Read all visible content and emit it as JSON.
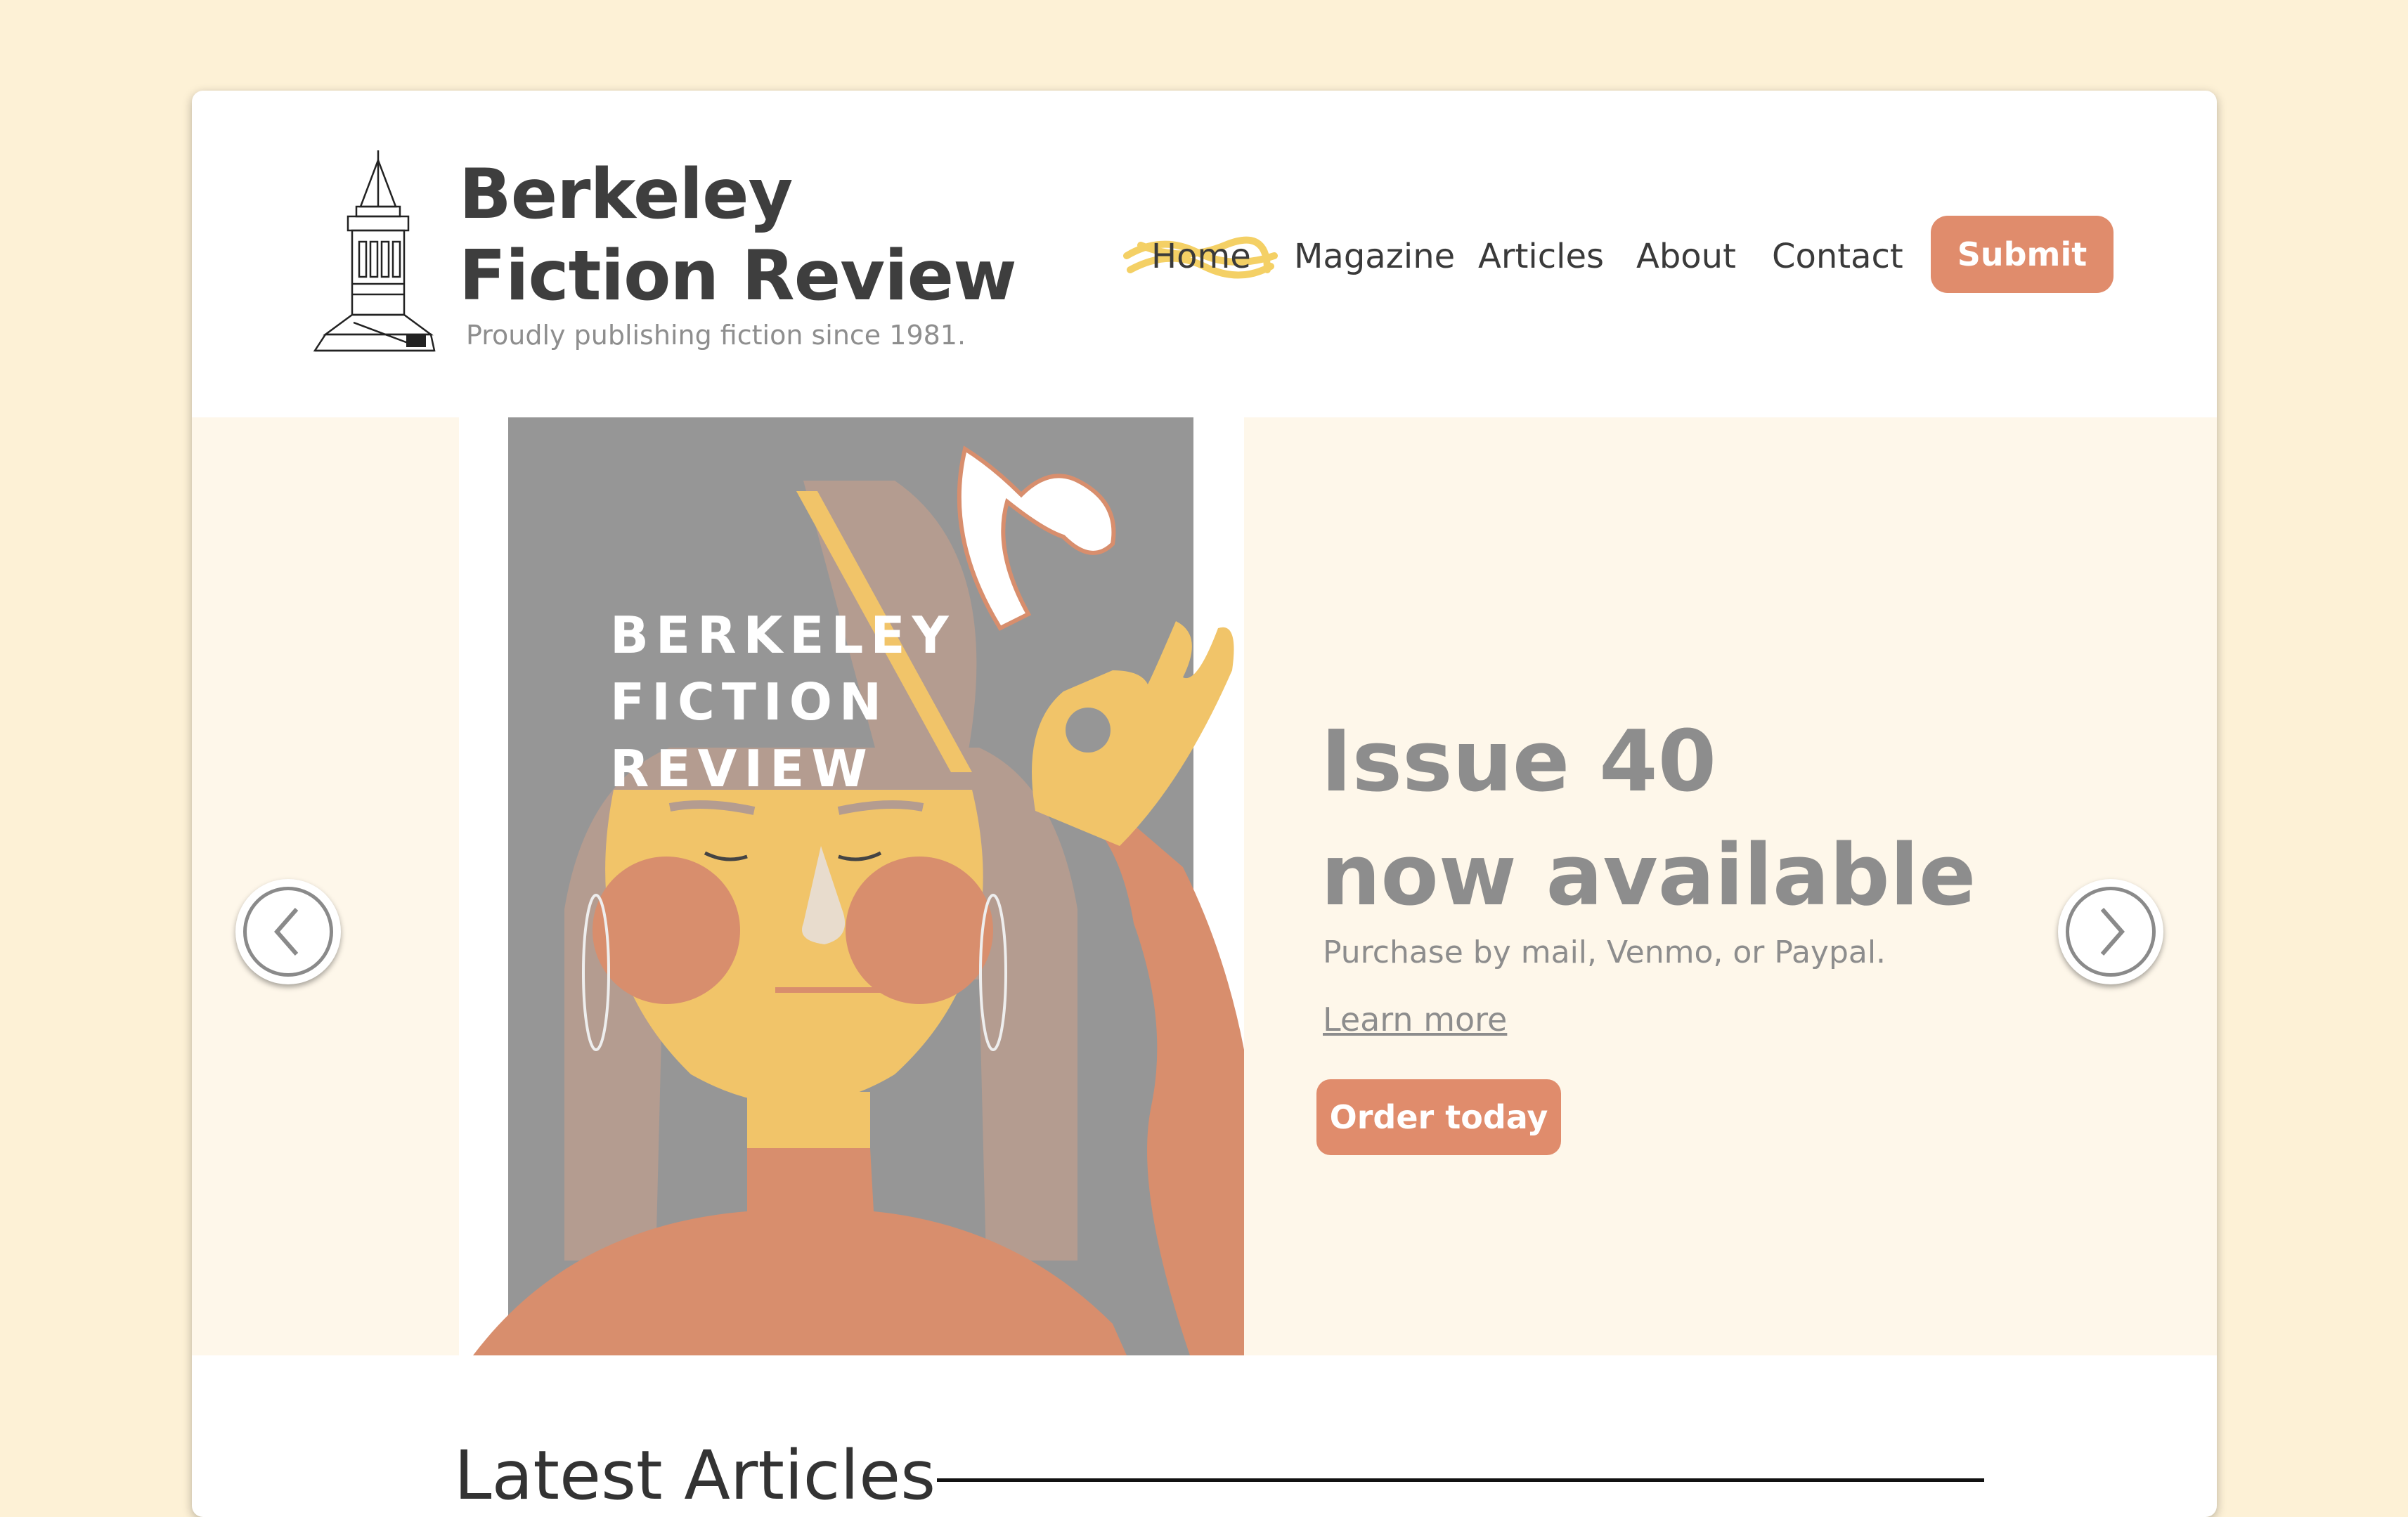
{
  "site": {
    "title": "Berkeley\nFiction Review",
    "tagline": "Proudly publishing fiction since 1981.",
    "logo_icon": "campanile-tower-icon"
  },
  "nav": {
    "items": [
      "Home",
      "Magazine",
      "Articles",
      "About",
      "Contact"
    ],
    "active": "Home",
    "submit_label": "Submit"
  },
  "hero": {
    "cover_title_lines": [
      "BERKELEY",
      "FICTION",
      "REVIEW"
    ],
    "heading": "Issue 40\nnow available",
    "subtext": "Purchase by mail, Venmo, or Paypal.",
    "learn_more": "Learn more",
    "order_label": "Order today",
    "prev_icon": "chevron-left-icon",
    "next_icon": "chevron-right-icon"
  },
  "latest": {
    "heading": "Latest Articles"
  },
  "colors": {
    "page_bg": "#fdf1d6",
    "hero_bg": "#fef7ea",
    "accent": "#e08c6c",
    "text_dark": "#3e3e3e",
    "text_muted": "#8d8d8d"
  }
}
